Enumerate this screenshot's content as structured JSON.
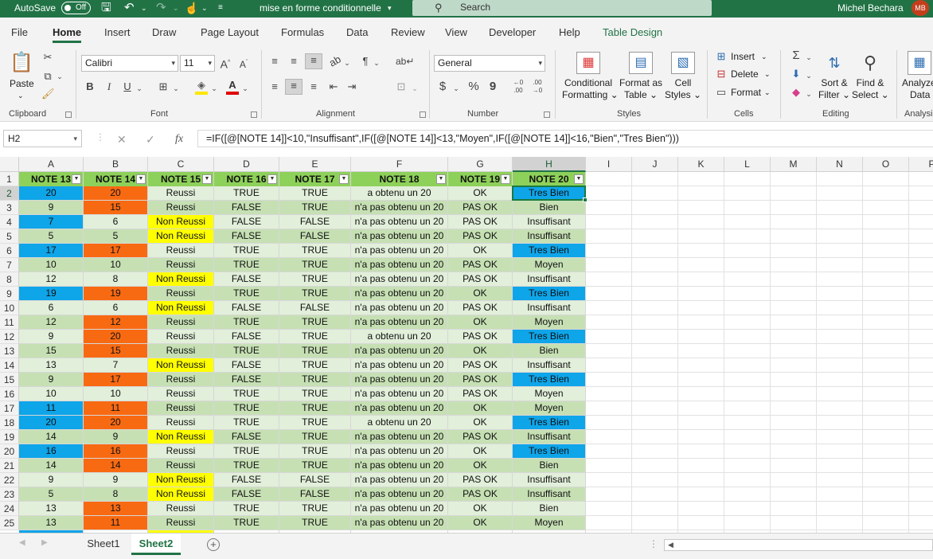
{
  "titlebar": {
    "autosave_label": "AutoSave",
    "autosave_state": "Off",
    "doc_title": "mise en forme conditionnelle",
    "doc_title_caret": "▾",
    "search_placeholder": "Search",
    "user_name": "Michel Bechara",
    "user_initials": "MB"
  },
  "menu": {
    "tabs": [
      "File",
      "Home",
      "Insert",
      "Draw",
      "Page Layout",
      "Formulas",
      "Data",
      "Review",
      "View",
      "Developer",
      "Help",
      "Table Design"
    ],
    "active": "Home"
  },
  "ribbon": {
    "clipboard": {
      "paste": "Paste",
      "label": "Clipboard"
    },
    "font": {
      "name": "Calibri",
      "size": "11",
      "label": "Font",
      "bold": "B",
      "italic": "I",
      "underline": "U"
    },
    "alignment": {
      "label": "Alignment"
    },
    "number": {
      "format": "General",
      "label": "Number",
      "currency": "$",
      "percent": "%",
      "comma": "9",
      "inc_decimal": ".00",
      "dec_decimal": ".00"
    },
    "styles": {
      "conditional": [
        "Conditional",
        "Formatting ⌄"
      ],
      "format_table": [
        "Format as",
        "Table ⌄"
      ],
      "cell_styles": [
        "Cell",
        "Styles ⌄"
      ],
      "label": "Styles"
    },
    "cells": {
      "insert": "Insert",
      "delete": "Delete",
      "format": "Format",
      "label": "Cells"
    },
    "editing": {
      "sort": [
        "Sort &",
        "Filter ⌄"
      ],
      "find": [
        "Find &",
        "Select ⌄"
      ],
      "label": "Editing"
    },
    "analysis": {
      "analyze": [
        "Analyze",
        "Data"
      ],
      "label": "Analysi"
    }
  },
  "formula_bar": {
    "name_box": "H2",
    "cancel": "✕",
    "enter": "✓",
    "fx": "fx",
    "formula": "=IF([@[NOTE 14]]<10,\"Insuffisant\",IF([@[NOTE 14]]<13,\"Moyen\",IF([@[NOTE 14]]<16,\"Bien\",\"Tres Bien\")))"
  },
  "sheet": {
    "columns": [
      "A",
      "B",
      "C",
      "D",
      "E",
      "F",
      "G",
      "H",
      "I",
      "J",
      "K",
      "L",
      "M",
      "N",
      "O",
      "P"
    ],
    "selected_column": "H",
    "selected_row": 2,
    "headers": [
      "NOTE 13",
      "NOTE 14",
      "NOTE 15",
      "NOTE 16",
      "NOTE 17",
      "NOTE 18",
      "NOTE 19",
      "NOTE 20"
    ],
    "rows": [
      [
        "20",
        "20",
        "Reussi",
        "TRUE",
        "TRUE",
        "a obtenu un 20",
        "OK",
        "Tres Bien"
      ],
      [
        "9",
        "15",
        "Reussi",
        "FALSE",
        "TRUE",
        "n'a pas obtenu un 20",
        "PAS OK",
        "Bien"
      ],
      [
        "7",
        "6",
        "Non Reussi",
        "FALSE",
        "FALSE",
        "n'a pas obtenu un 20",
        "PAS OK",
        "Insuffisant"
      ],
      [
        "5",
        "5",
        "Non Reussi",
        "FALSE",
        "FALSE",
        "n'a pas obtenu un 20",
        "PAS OK",
        "Insuffisant"
      ],
      [
        "17",
        "17",
        "Reussi",
        "TRUE",
        "TRUE",
        "n'a pas obtenu un 20",
        "OK",
        "Tres Bien"
      ],
      [
        "10",
        "10",
        "Reussi",
        "TRUE",
        "TRUE",
        "n'a pas obtenu un 20",
        "PAS OK",
        "Moyen"
      ],
      [
        "12",
        "8",
        "Non Reussi",
        "FALSE",
        "TRUE",
        "n'a pas obtenu un 20",
        "PAS OK",
        "Insuffisant"
      ],
      [
        "19",
        "19",
        "Reussi",
        "TRUE",
        "TRUE",
        "n'a pas obtenu un 20",
        "OK",
        "Tres Bien"
      ],
      [
        "6",
        "6",
        "Non Reussi",
        "FALSE",
        "FALSE",
        "n'a pas obtenu un 20",
        "PAS OK",
        "Insuffisant"
      ],
      [
        "12",
        "12",
        "Reussi",
        "TRUE",
        "TRUE",
        "n'a pas obtenu un 20",
        "OK",
        "Moyen"
      ],
      [
        "9",
        "20",
        "Reussi",
        "FALSE",
        "TRUE",
        "a obtenu un 20",
        "PAS OK",
        "Tres Bien"
      ],
      [
        "15",
        "15",
        "Reussi",
        "TRUE",
        "TRUE",
        "n'a pas obtenu un 20",
        "OK",
        "Bien"
      ],
      [
        "13",
        "7",
        "Non Reussi",
        "FALSE",
        "TRUE",
        "n'a pas obtenu un 20",
        "PAS OK",
        "Insuffisant"
      ],
      [
        "9",
        "17",
        "Reussi",
        "FALSE",
        "TRUE",
        "n'a pas obtenu un 20",
        "PAS OK",
        "Tres Bien"
      ],
      [
        "10",
        "10",
        "Reussi",
        "TRUE",
        "TRUE",
        "n'a pas obtenu un 20",
        "PAS OK",
        "Moyen"
      ],
      [
        "11",
        "11",
        "Reussi",
        "TRUE",
        "TRUE",
        "n'a pas obtenu un 20",
        "OK",
        "Moyen"
      ],
      [
        "20",
        "20",
        "Reussi",
        "TRUE",
        "TRUE",
        "a obtenu un 20",
        "OK",
        "Tres Bien"
      ],
      [
        "14",
        "9",
        "Non Reussi",
        "FALSE",
        "TRUE",
        "n'a pas obtenu un 20",
        "PAS OK",
        "Insuffisant"
      ],
      [
        "16",
        "16",
        "Reussi",
        "TRUE",
        "TRUE",
        "n'a pas obtenu un 20",
        "OK",
        "Tres Bien"
      ],
      [
        "14",
        "14",
        "Reussi",
        "TRUE",
        "TRUE",
        "n'a pas obtenu un 20",
        "OK",
        "Bien"
      ],
      [
        "9",
        "9",
        "Non Reussi",
        "FALSE",
        "FALSE",
        "n'a pas obtenu un 20",
        "PAS OK",
        "Insuffisant"
      ],
      [
        "5",
        "8",
        "Non Reussi",
        "FALSE",
        "FALSE",
        "n'a pas obtenu un 20",
        "PAS OK",
        "Insuffisant"
      ],
      [
        "13",
        "13",
        "Reussi",
        "TRUE",
        "TRUE",
        "n'a pas obtenu un 20",
        "OK",
        "Bien"
      ],
      [
        "13",
        "11",
        "Reussi",
        "TRUE",
        "TRUE",
        "n'a pas obtenu un 20",
        "OK",
        "Moyen"
      ]
    ]
  },
  "colors": {
    "excel_green": "#217346",
    "header_green": "#8ed15a",
    "band_light": "#e2efda",
    "band_dark": "#c6e0b4",
    "highlight_blue": "#0ea5e9",
    "highlight_orange": "#f86a12",
    "highlight_yellow": "#ffff00"
  },
  "sheet_tabs": {
    "tabs": [
      "Sheet1",
      "Sheet2"
    ],
    "active": "Sheet2",
    "add": "+"
  }
}
